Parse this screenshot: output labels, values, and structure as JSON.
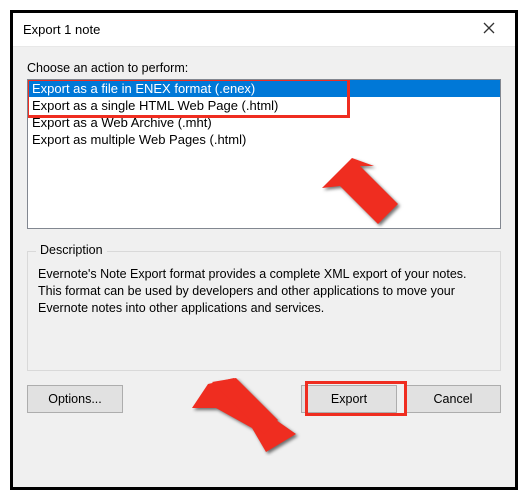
{
  "window": {
    "title": "Export 1 note"
  },
  "choose_label": "Choose an action to perform:",
  "actions": [
    "Export as a file in ENEX format (.enex)",
    "Export as a single HTML Web Page (.html)",
    "Export as a Web Archive (.mht)",
    "Export as multiple Web Pages (.html)"
  ],
  "selected_index": 0,
  "description": {
    "legend": "Description",
    "text": "Evernote's Note Export format provides a complete XML export of your notes. This format can be used by developers and other applications to move your Evernote notes into other applications and services."
  },
  "buttons": {
    "options": "Options...",
    "export": "Export",
    "cancel": "Cancel"
  },
  "annotation_color": "#ef2d20"
}
